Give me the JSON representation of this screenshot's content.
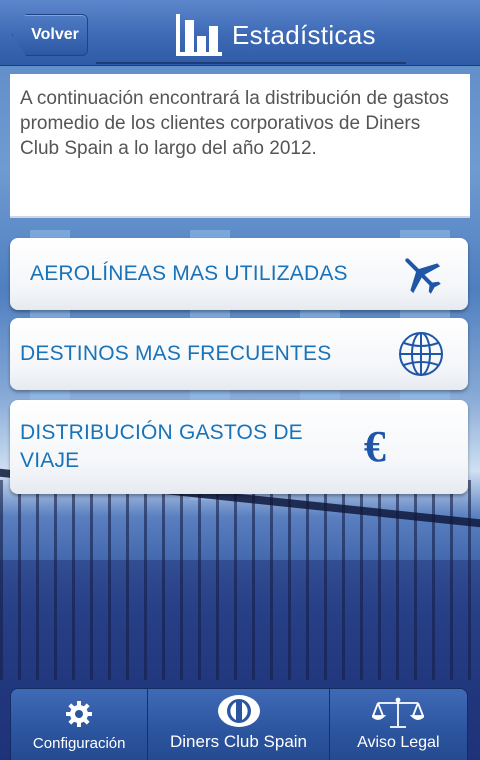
{
  "header": {
    "back_label": "Volver",
    "title": "Estadísticas"
  },
  "intro": {
    "text": "A continuación encontrará la distribución de gastos promedio de los clientes corporativos de Diners Club Spain a lo largo del año 2012."
  },
  "menu": {
    "items": [
      {
        "label": "AEROLÍNEAS MAS UTILIZADAS",
        "icon": "airplane-icon"
      },
      {
        "label": "DESTINOS MAS FRECUENTES",
        "icon": "globe-icon"
      },
      {
        "label": "DISTRIBUCIÓN GASTOS DE VIAJE",
        "icon": "euro-icon",
        "icon_text": "€"
      }
    ]
  },
  "tabbar": {
    "tabs": [
      {
        "label": "Configuración",
        "icon": "gear-icon"
      },
      {
        "label": "Diners Club Spain",
        "icon": "diners-club-logo-icon"
      },
      {
        "label": "Aviso Legal",
        "icon": "scales-icon"
      }
    ]
  },
  "colors": {
    "header": "#3d69b5",
    "menu_text": "#1a73b8",
    "icon_blue": "#1f56a8"
  }
}
